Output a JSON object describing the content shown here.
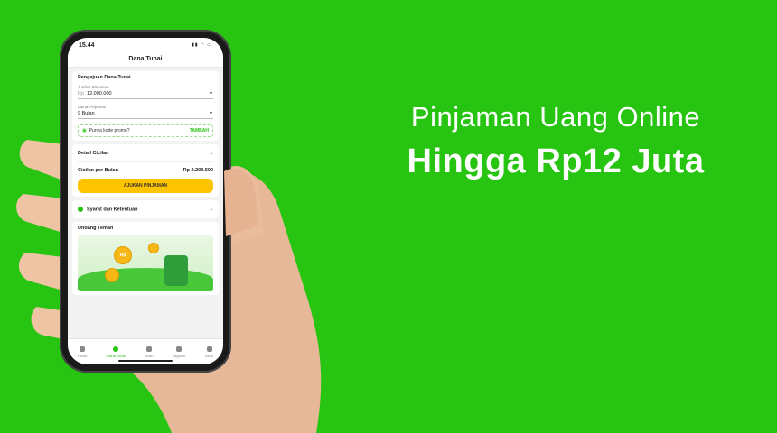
{
  "headline": {
    "line1": "Pinjaman Uang Online",
    "line2": "Hingga Rp12 Juta"
  },
  "colors": {
    "brand_green": "#28c412",
    "cta_yellow": "#ffc400"
  },
  "phone": {
    "status_time": "15.44",
    "app_title": "Dana Tunai",
    "form": {
      "title": "Pengajuan Dana Tunai",
      "amount_label": "Jumlah Pinjaman",
      "amount_prefix": "Rp",
      "amount_value": "12.000.000",
      "tenor_label": "Lama Pinjaman",
      "tenor_value": "9 Bulan",
      "promo_text": "Punya kode promo?",
      "promo_button": "TAMBAH",
      "detail_label": "Detail Cicilan",
      "monthly_label": "Cicilan per Bulan",
      "monthly_value": "Rp 2.209.500",
      "submit_label": "AJUKAN PINJAMAN"
    },
    "terms_label": "Syarat dan Ketentuan",
    "invite": {
      "title": "Undang Teman",
      "coin_label": "Rp"
    },
    "tabs": [
      {
        "label": "Home",
        "icon": "home-icon"
      },
      {
        "label": "Dana Tunai",
        "icon": "cash-icon"
      },
      {
        "label": "Scan",
        "icon": "scan-icon"
      },
      {
        "label": "Tagihan",
        "icon": "bill-icon"
      },
      {
        "label": "Akun",
        "icon": "account-icon"
      }
    ]
  }
}
